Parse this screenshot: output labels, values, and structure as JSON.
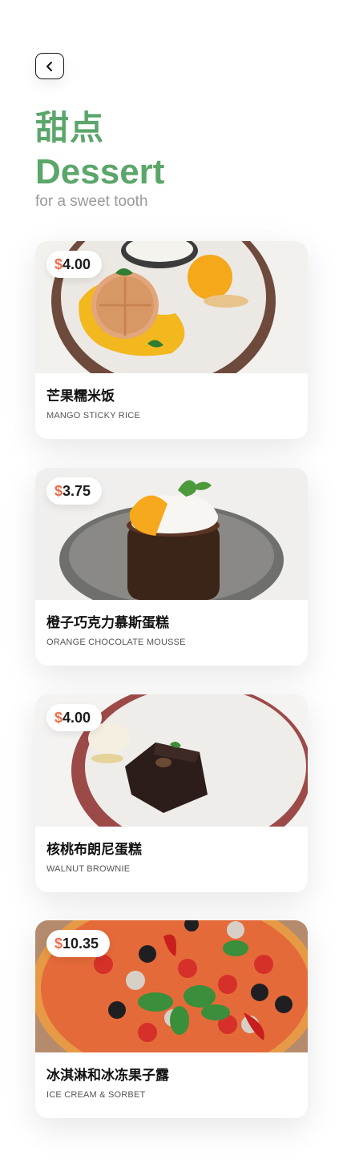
{
  "header": {
    "title_zh": "甜点",
    "title_en": "Dessert",
    "subtitle": "for a sweet tooth"
  },
  "colors": {
    "accent_green": "#5ba66a",
    "price_currency": "#ea6e4d"
  },
  "items": [
    {
      "currency": "$",
      "price": "4.00",
      "name_zh": "芒果糯米饭",
      "name_en": "MANGO STICKY RICE",
      "image": "mango-sticky-rice-photo"
    },
    {
      "currency": "$",
      "price": "3.75",
      "name_zh": "橙子巧克力慕斯蛋糕",
      "name_en": "ORANGE CHOCOLATE MOUSSE",
      "image": "orange-chocolate-mousse-photo"
    },
    {
      "currency": "$",
      "price": "4.00",
      "name_zh": "核桃布朗尼蛋糕",
      "name_en": "WALNUT BROWNIE",
      "image": "walnut-brownie-photo"
    },
    {
      "currency": "$",
      "price": "10.35",
      "name_zh": "冰淇淋和冰冻果子露",
      "name_en": "ICE CREAM & SORBET",
      "image": "pizza-photo"
    }
  ]
}
